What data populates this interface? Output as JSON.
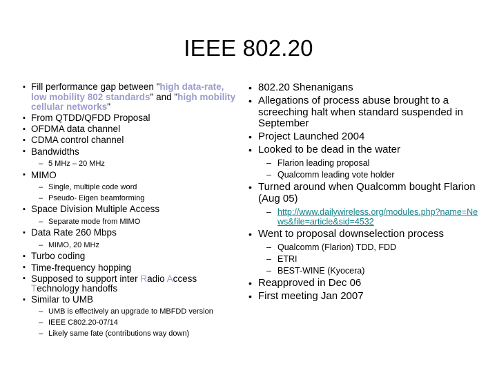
{
  "slide": {
    "title": "IEEE 802.20",
    "accent_highlight_color": "#9c9cce",
    "link_color": "#15818c",
    "background_color": "#ffffff",
    "text_color": "#000000"
  },
  "left_column": {
    "bullet_glyph": "square",
    "items": [
      {
        "id": "fill-performance-gap",
        "segments": [
          {
            "text": "Fill performance gap between \"",
            "style": "plain"
          },
          {
            "text": "high data-rate, low mobility 802 standards",
            "style": "highlight"
          },
          {
            "text": "\" and \"",
            "style": "plain"
          },
          {
            "text": "high mobility cellular networks",
            "style": "highlight"
          },
          {
            "text": "\"",
            "style": "plain"
          }
        ],
        "plain": "Fill performance gap between \"high data-rate, low mobility 802 standards\" and \"high mobility cellular networks\""
      },
      {
        "id": "qtdd-qfdd-proposal",
        "plain": "From QTDD/QFDD Proposal"
      },
      {
        "id": "ofdma-data-channel",
        "plain": "OFDMA data channel"
      },
      {
        "id": "cdma-control-channel",
        "plain": "CDMA control channel"
      },
      {
        "id": "bandwidths",
        "plain": "Bandwidths",
        "sub": [
          {
            "id": "bandwidth-range",
            "plain": "5 MHz – 20 MHz"
          }
        ]
      },
      {
        "id": "mimo",
        "plain": "MIMO",
        "sub": [
          {
            "id": "single-multiple-code-word",
            "plain": "Single, multiple code word"
          },
          {
            "id": "pseudo-eigen-beamforming",
            "plain": "Pseudo- Eigen beamforming"
          }
        ]
      },
      {
        "id": "space-division-multiple-access",
        "plain": "Space Division Multiple Access",
        "sub": [
          {
            "id": "separate-mode-from-mimo",
            "plain": "Separate mode from MIMO"
          }
        ]
      },
      {
        "id": "data-rate",
        "plain": "Data Rate 260 Mbps",
        "sub": [
          {
            "id": "mimo-20mhz",
            "plain": "MIMO, 20 MHz"
          }
        ]
      },
      {
        "id": "turbo-coding",
        "plain": "Turbo coding"
      },
      {
        "id": "time-frequency-hopping",
        "plain": "Time-frequency hopping"
      },
      {
        "id": "inter-rat-handoffs",
        "segments": [
          {
            "text": "Supposed to support inter ",
            "style": "plain"
          },
          {
            "text": "R",
            "style": "highlight-plain"
          },
          {
            "text": "adio ",
            "style": "plain"
          },
          {
            "text": "A",
            "style": "highlight-plain"
          },
          {
            "text": "ccess ",
            "style": "plain"
          },
          {
            "text": "T",
            "style": "highlight-plain"
          },
          {
            "text": "echnology handoffs",
            "style": "plain"
          }
        ],
        "plain": "Supposed to support inter Radio Access Technology handoffs"
      },
      {
        "id": "similar-to-umb",
        "plain": "Similar to UMB",
        "sub": [
          {
            "id": "umb-upgrade-mbfdd",
            "plain": "UMB is effectively an upgrade to MBFDD version"
          },
          {
            "id": "ieee-doc-number",
            "plain": "IEEE C802.20-07/14"
          },
          {
            "id": "likely-same-fate",
            "plain": "Likely same fate (contributions way down)"
          }
        ]
      }
    ]
  },
  "right_column": {
    "bullet_glyph": "round",
    "items": [
      {
        "id": "shenanigans",
        "plain": "802.20 Shenanigans"
      },
      {
        "id": "allegations-process-abuse",
        "plain": "Allegations of process abuse brought to a screeching halt when standard suspended in September"
      },
      {
        "id": "project-launched",
        "plain": "Project Launched 2004"
      },
      {
        "id": "dead-in-the-water",
        "plain": "Looked to be dead in the water",
        "sub": [
          {
            "id": "flarion-leading-proposal",
            "plain": "Flarion leading proposal"
          },
          {
            "id": "qualcomm-vote-holder",
            "plain": "Qualcomm leading vote holder"
          }
        ]
      },
      {
        "id": "qualcomm-bought-flarion",
        "plain": "Turned around when Qualcomm bought Flarion (Aug 05)",
        "sub": [
          {
            "id": "dailywireless-link",
            "plain": "http://www.dailywireless.org/modules.php?name=News&file=article&sid=4532",
            "style": "link"
          }
        ]
      },
      {
        "id": "proposal-downselection",
        "plain": "Went to proposal downselection process",
        "sub": [
          {
            "id": "qualcomm-flarion-tdd-fdd",
            "plain": "Qualcomm (Flarion) TDD, FDD"
          },
          {
            "id": "etri",
            "plain": "ETRI"
          },
          {
            "id": "best-wine-kyocera",
            "plain": "BEST-WINE (Kyocera)"
          }
        ]
      },
      {
        "id": "reapproved-dec-06",
        "plain": "Reapproved in Dec 06"
      },
      {
        "id": "first-meeting-jan-2007",
        "plain": "First meeting Jan 2007"
      }
    ]
  }
}
